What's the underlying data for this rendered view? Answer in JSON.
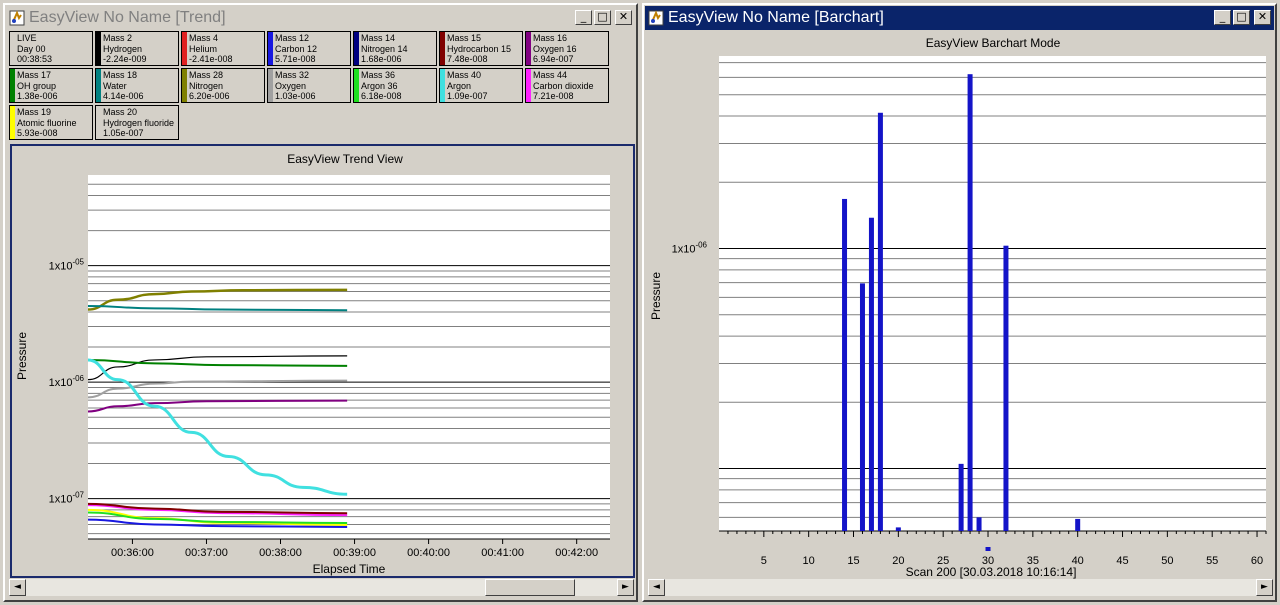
{
  "trend_window": {
    "title": "EasyView No Name [Trend]",
    "buttons": {
      "minimize": "_",
      "maximize": "□",
      "close": "✕"
    },
    "legend": [
      {
        "l1": "LIVE",
        "l2": "Day 00",
        "l3": "00:38:53",
        "color": "#d4d0c8"
      },
      {
        "l1": "Mass 2",
        "l2": "Hydrogen",
        "l3": "-2.24e-009",
        "color": "#000000"
      },
      {
        "l1": "Mass 4",
        "l2": "Helium",
        "l3": "-2.41e-008",
        "color": "#e02020"
      },
      {
        "l1": "Mass 12",
        "l2": "Carbon 12",
        "l3": "5.71e-008",
        "color": "#1818e0"
      },
      {
        "l1": "Mass 14",
        "l2": "Nitrogen 14",
        "l3": "1.68e-006",
        "color": "#000080"
      },
      {
        "l1": "Mass 15",
        "l2": "Hydrocarbon 15",
        "l3": "7.48e-008",
        "color": "#800000"
      },
      {
        "l1": "Mass 16",
        "l2": "Oxygen 16",
        "l3": "6.94e-007",
        "color": "#800080"
      },
      {
        "l1": "Mass 17",
        "l2": "OH group",
        "l3": "1.38e-006",
        "color": "#008000"
      },
      {
        "l1": "Mass 18",
        "l2": "Water",
        "l3": "4.14e-006",
        "color": "#008080"
      },
      {
        "l1": "Mass 28",
        "l2": "Nitrogen",
        "l3": "6.20e-006",
        "color": "#808000"
      },
      {
        "l1": "Mass 32",
        "l2": "Oxygen",
        "l3": "1.03e-006",
        "color": "#a0a0a0"
      },
      {
        "l1": "Mass 36",
        "l2": "Argon 36",
        "l3": "6.18e-008",
        "color": "#20e020"
      },
      {
        "l1": "Mass 40",
        "l2": "Argon",
        "l3": "1.09e-007",
        "color": "#40e0e0"
      },
      {
        "l1": "Mass 44",
        "l2": "Carbon dioxide",
        "l3": "7.21e-008",
        "color": "#ff20ff"
      },
      {
        "l1": "Mass 19",
        "l2": "Atomic fluorine",
        "l3": "5.93e-008",
        "color": "#ffff00"
      },
      {
        "l1": "Mass 20",
        "l2": "Hydrogen fluoride",
        "l3": "1.05e-007",
        "color": "#d4d0c8"
      }
    ]
  },
  "bar_window": {
    "title": "EasyView No Name [Barchart]",
    "buttons": {
      "minimize": "_",
      "maximize": "□",
      "close": "✕"
    }
  },
  "scroll": {
    "left": "◄",
    "right": "►"
  },
  "chart_data": [
    {
      "type": "line",
      "title": "EasyView Trend View",
      "xlabel": "Elapsed Time",
      "ylabel": "Pressure",
      "y_scale": "log",
      "ylim": [
        4.5e-08,
        6e-05
      ],
      "yticks": [
        "1x10-07",
        "1x10-06",
        "1x10-05"
      ],
      "x_ticks": [
        "00:36:00",
        "00:37:00",
        "00:38:00",
        "00:39:00",
        "00:40:00",
        "00:41:00",
        "00:42:00"
      ],
      "x_domain_minutes": [
        35.4,
        42.45
      ],
      "grid": true,
      "series": [
        {
          "color": "#808000",
          "x": [
            35.4,
            35.8,
            36.3,
            36.8,
            37.5,
            38.9
          ],
          "y": [
            4.2e-06,
            5.1e-06,
            5.7e-06,
            6e-06,
            6.15e-06,
            6.2e-06
          ]
        },
        {
          "color": "#008080",
          "x": [
            35.4,
            36.3,
            37.2,
            38.9
          ],
          "y": [
            4.5e-06,
            4.3e-06,
            4.2e-06,
            4.14e-06
          ]
        },
        {
          "color": "#000000",
          "x": [
            35.4,
            35.8,
            36.3,
            37.0,
            38.9
          ],
          "y": [
            1.05e-06,
            1.35e-06,
            1.55e-06,
            1.65e-06,
            1.68e-06
          ]
        },
        {
          "color": "#008000",
          "x": [
            35.4,
            36.3,
            37.2,
            38.9
          ],
          "y": [
            1.55e-06,
            1.45e-06,
            1.4e-06,
            1.38e-06
          ]
        },
        {
          "color": "#a0a0a0",
          "x": [
            35.4,
            35.8,
            36.3,
            36.8,
            38.9
          ],
          "y": [
            7.4e-07,
            8.8e-07,
            9.7e-07,
            1.01e-06,
            1.03e-06
          ]
        },
        {
          "color": "#800080",
          "x": [
            35.4,
            35.8,
            36.3,
            37.0,
            38.9
          ],
          "y": [
            5.6e-07,
            6.2e-07,
            6.6e-07,
            6.85e-07,
            6.94e-07
          ]
        },
        {
          "color": "#40e0e0",
          "x": [
            35.4,
            35.8,
            36.3,
            36.8,
            37.3,
            37.8,
            38.3,
            38.9
          ],
          "y": [
            1.55e-06,
            1.05e-06,
            6.2e-07,
            3.7e-07,
            2.3e-07,
            1.6e-07,
            1.25e-07,
            1.09e-07
          ]
        },
        {
          "color": "#ff20ff",
          "x": [
            35.4,
            36.3,
            37.2,
            38.9
          ],
          "y": [
            8.8e-08,
            8e-08,
            7.5e-08,
            7.21e-08
          ]
        },
        {
          "color": "#800000",
          "x": [
            35.4,
            36.3,
            37.2,
            38.9
          ],
          "y": [
            9e-08,
            8.2e-08,
            7.7e-08,
            7.48e-08
          ]
        },
        {
          "color": "#ffff00",
          "x": [
            35.4,
            36.3,
            37.2,
            38.9
          ],
          "y": [
            8e-08,
            6.8e-08,
            6.2e-08,
            5.93e-08
          ]
        },
        {
          "color": "#20e020",
          "x": [
            35.4,
            36.3,
            37.2,
            38.9
          ],
          "y": [
            7.6e-08,
            6.7e-08,
            6.3e-08,
            6.18e-08
          ]
        },
        {
          "color": "#1818e0",
          "x": [
            35.4,
            36.3,
            37.2,
            38.9
          ],
          "y": [
            6.6e-08,
            6e-08,
            5.8e-08,
            5.71e-08
          ]
        }
      ]
    },
    {
      "type": "bar",
      "title": "EasyView Barchart Mode",
      "xlabel": "Scan 200 [30.03.2018 10:16:14]",
      "ylabel": "Pressure",
      "y_scale": "log",
      "ylim": [
        5.2e-08,
        7.5e-06
      ],
      "yticks": [
        "1x10-06"
      ],
      "x_ticks": [
        "5",
        "10",
        "15",
        "20",
        "25",
        "30",
        "35",
        "40",
        "45",
        "50",
        "55",
        "60"
      ],
      "xlim": [
        0,
        61
      ],
      "grid": true,
      "bars": [
        {
          "x": 14,
          "y": 1.68e-06
        },
        {
          "x": 16,
          "y": 6.94e-07
        },
        {
          "x": 17,
          "y": 1.38e-06
        },
        {
          "x": 18,
          "y": 4.14e-06
        },
        {
          "x": 20,
          "y": 5.4e-08
        },
        {
          "x": 27,
          "y": 1.05e-07
        },
        {
          "x": 28,
          "y": 6.2e-06
        },
        {
          "x": 29,
          "y": 6e-08
        },
        {
          "x": 30,
          "y": 5e-08
        },
        {
          "x": 32,
          "y": 1.03e-06
        },
        {
          "x": 40,
          "y": 5.9e-08
        }
      ],
      "bar_color": "#1414c8"
    }
  ]
}
